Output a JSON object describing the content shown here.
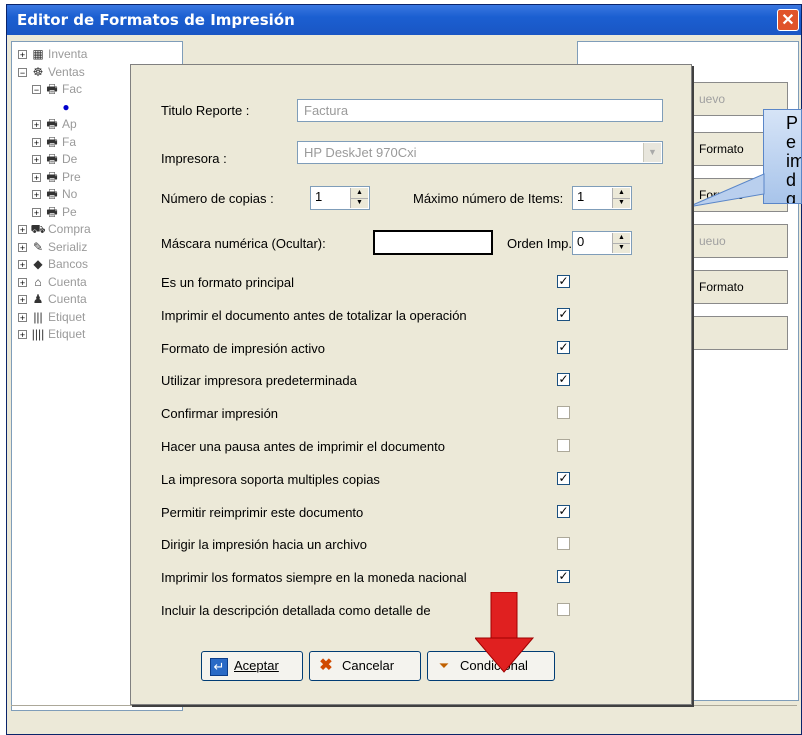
{
  "window": {
    "title": "Editor de Formatos de Impresión",
    "close_glyph": "✕"
  },
  "tree": {
    "items": [
      {
        "label": "Inventa",
        "icon": "inventory-icon",
        "glyph": "▦",
        "expander": "+",
        "level": 0
      },
      {
        "label": "Ventas",
        "icon": "handshake-icon",
        "glyph": "☸",
        "expander": "−",
        "level": 0
      },
      {
        "label": "Fac",
        "icon": "printer-icon",
        "glyph": "🖶",
        "expander": "−",
        "level": 1
      },
      {
        "label": "",
        "icon": "bullet-icon",
        "glyph": "●",
        "expander": "",
        "level": 2
      },
      {
        "label": "Ap",
        "icon": "printer-icon",
        "glyph": "🖶",
        "expander": "+",
        "level": 1
      },
      {
        "label": "Fa",
        "icon": "printer-icon",
        "glyph": "🖶",
        "expander": "+",
        "level": 1
      },
      {
        "label": "De",
        "icon": "printer-icon",
        "glyph": "🖶",
        "expander": "+",
        "level": 1
      },
      {
        "label": "Pre",
        "icon": "printer-icon",
        "glyph": "🖶",
        "expander": "+",
        "level": 1
      },
      {
        "label": "No",
        "icon": "printer-icon",
        "glyph": "🖶",
        "expander": "+",
        "level": 1
      },
      {
        "label": "Pe",
        "icon": "printer-icon",
        "glyph": "🖶",
        "expander": "+",
        "level": 1
      },
      {
        "label": "Compra",
        "icon": "truck-icon",
        "glyph": "⛟",
        "expander": "+",
        "level": 0
      },
      {
        "label": "Serializ",
        "icon": "tag-icon",
        "glyph": "✎",
        "expander": "+",
        "level": 0
      },
      {
        "label": "Bancos",
        "icon": "bank-icon",
        "glyph": "◆",
        "expander": "+",
        "level": 0
      },
      {
        "label": "Cuenta",
        "icon": "accounts-icon",
        "glyph": "⌂",
        "expander": "+",
        "level": 0
      },
      {
        "label": "Cuenta",
        "icon": "users-icon",
        "glyph": "♟",
        "expander": "+",
        "level": 0
      },
      {
        "label": "Etiquet",
        "icon": "barcode-icon",
        "glyph": "|||",
        "expander": "+",
        "level": 0
      },
      {
        "label": "Etiquet",
        "icon": "barcode-icon",
        "glyph": "||||",
        "expander": "+",
        "level": 0
      }
    ]
  },
  "right_panel": {
    "buttons": [
      "uevo",
      "Formato",
      "Formato",
      "ueuo",
      "Formato",
      ""
    ]
  },
  "callout": {
    "lines": [
      "P",
      "e",
      "im",
      "d",
      "g"
    ]
  },
  "dialog": {
    "titulo_label": "Titulo Reporte :",
    "titulo_value": "Factura",
    "impresora_label": "Impresora :",
    "impresora_value": "HP DeskJet 970Cxi",
    "copias_label": "Número de copias :",
    "copias_value": "1",
    "max_items_label": "Máximo número de Items:",
    "max_items_value": "1",
    "mascara_label": "Máscara numérica (Ocultar):",
    "mascara_value": "",
    "orden_label": "Orden  Imp. :",
    "orden_value": "0",
    "options": [
      {
        "label": "Es un formato principal",
        "checked": true,
        "mark": "✓"
      },
      {
        "label": "Imprimir el documento antes de totalizar la operación",
        "checked": true,
        "mark": "✓"
      },
      {
        "label": "Formato de impresión activo",
        "checked": true,
        "mark": "✓"
      },
      {
        "label": "Utilizar impresora predeterminada",
        "checked": true,
        "mark": "✓"
      },
      {
        "label": "Confirmar impresión",
        "checked": false,
        "mark": ""
      },
      {
        "label": "Hacer una pausa antes de imprimir el documento",
        "checked": false,
        "mark": ""
      },
      {
        "label": "La impresora soporta multiples copias",
        "checked": true,
        "mark": "✓"
      },
      {
        "label": "Permitir reimprimir  este documento",
        "checked": true,
        "mark": "✓"
      },
      {
        "label": "Dirigir la impresión hacia un archivo",
        "checked": false,
        "mark": ""
      },
      {
        "label": "Imprimir los formatos siempre en la moneda nacional",
        "checked": true,
        "mark": "✓"
      },
      {
        "label": "Incluir la descripción detallada como detalle de",
        "checked": false,
        "mark": ""
      }
    ],
    "buttons": {
      "aceptar": "Aceptar",
      "cancelar": "Cancelar",
      "condicional": "Condicional"
    }
  },
  "colors": {
    "accent": "#e02020",
    "titlebar": "#1b5fd1"
  }
}
